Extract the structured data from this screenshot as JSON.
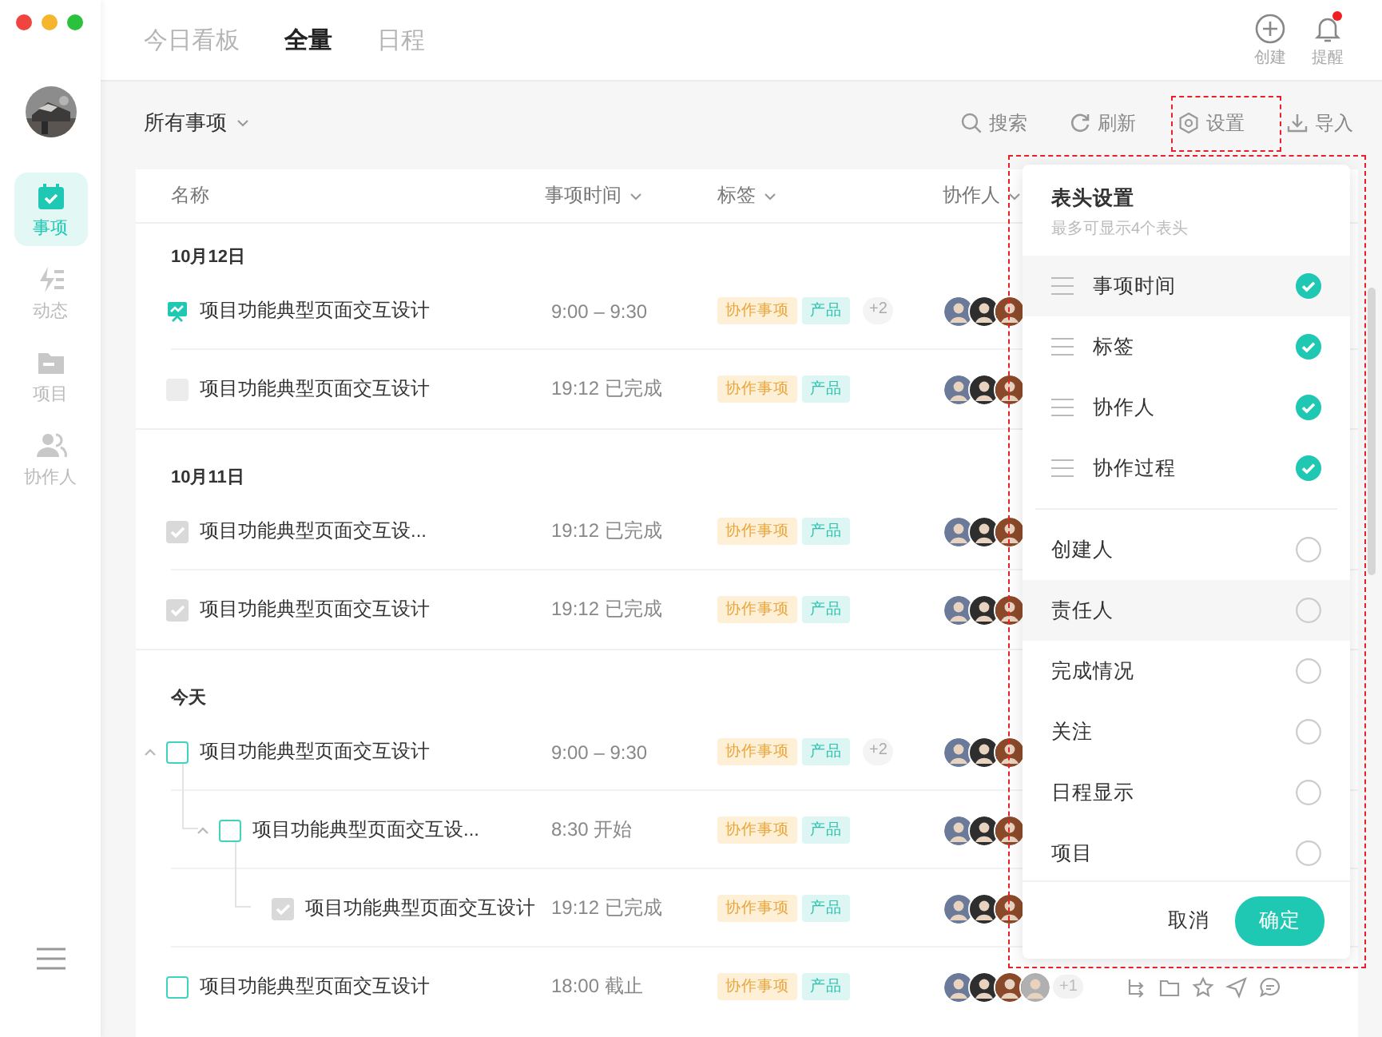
{
  "sidebar": {
    "nav": [
      {
        "label": "事项",
        "kind": "calendar",
        "selected": true
      },
      {
        "label": "动态",
        "kind": "activity",
        "selected": false
      },
      {
        "label": "项目",
        "kind": "folder",
        "selected": false
      },
      {
        "label": "协作人",
        "kind": "people",
        "selected": false
      }
    ]
  },
  "tabs": [
    {
      "label": "今日看板",
      "selected": false
    },
    {
      "label": "全量",
      "selected": true
    },
    {
      "label": "日程",
      "selected": false
    }
  ],
  "header_actions": [
    {
      "label": "创建",
      "kind": "create",
      "badge": false
    },
    {
      "label": "提醒",
      "kind": "bell",
      "badge": true
    }
  ],
  "filter": {
    "label": "所有事项"
  },
  "toolbar": [
    {
      "label": "搜索",
      "kind": "search"
    },
    {
      "label": "刷新",
      "kind": "refresh"
    },
    {
      "label": "设置",
      "kind": "settings"
    },
    {
      "label": "导入",
      "kind": "import"
    }
  ],
  "table": {
    "columns": [
      {
        "label": "名称",
        "sortable": false
      },
      {
        "label": "事项时间",
        "sortable": true
      },
      {
        "label": "标签",
        "sortable": true
      },
      {
        "label": "协作人",
        "sortable": true
      }
    ],
    "groups": [
      {
        "label": "10月12日",
        "rows": [
          {
            "title": "项目功能典型页面交互设计",
            "kind": "milestone",
            "time": "9:00 – 9:30",
            "tags": [
              {
                "label": "协作事项",
                "kind": "collab"
              },
              {
                "label": "产品",
                "kind": "product"
              },
              {
                "label": "+2",
                "kind": "more"
              }
            ]
          },
          {
            "title": "项目功能典型页面交互设计",
            "kind": "placeholder",
            "time": "19:12 已完成",
            "tags": [
              {
                "label": "协作事项",
                "kind": "collab"
              },
              {
                "label": "产品",
                "kind": "product"
              }
            ]
          }
        ]
      },
      {
        "label": "10月11日",
        "rows": [
          {
            "title": "项目功能典型页面交互设...",
            "kind": "done",
            "time": "19:12 已完成",
            "tags": [
              {
                "label": "协作事项",
                "kind": "collab"
              },
              {
                "label": "产品",
                "kind": "product"
              }
            ]
          },
          {
            "title": "项目功能典型页面交互设计",
            "kind": "done",
            "time": "19:12 已完成",
            "tags": [
              {
                "label": "协作事项",
                "kind": "collab"
              },
              {
                "label": "产品",
                "kind": "product"
              }
            ]
          }
        ]
      },
      {
        "label": "今天",
        "rows": [
          {
            "title": "项目功能典型页面交互设计",
            "kind": "open",
            "time": "9:00 – 9:30",
            "expanded": true,
            "tags": [
              {
                "label": "协作事项",
                "kind": "collab"
              },
              {
                "label": "产品",
                "kind": "product"
              },
              {
                "label": "+2",
                "kind": "more"
              }
            ],
            "children": [
              {
                "title": "项目功能典型页面交互设...",
                "kind": "open",
                "time": "8:30 开始",
                "expanded": true,
                "tags": [
                  {
                    "label": "协作事项",
                    "kind": "collab"
                  },
                  {
                    "label": "产品",
                    "kind": "product"
                  }
                ],
                "children": [
                  {
                    "title": "项目功能典型页面交互设计",
                    "kind": "done",
                    "time": "19:12 已完成",
                    "tags": [
                      {
                        "label": "协作事项",
                        "kind": "collab"
                      },
                      {
                        "label": "产品",
                        "kind": "product"
                      }
                    ]
                  }
                ]
              }
            ]
          },
          {
            "title": "项目功能典型页面交互设计",
            "kind": "open",
            "time": "18:00 截止",
            "tags": [
              {
                "label": "协作事项",
                "kind": "collab"
              },
              {
                "label": "产品",
                "kind": "product"
              }
            ],
            "more_people": "+1",
            "show_actions": true
          }
        ]
      }
    ]
  },
  "column_settings": {
    "title": "表头设置",
    "subtitle": "最多可显示4个表头",
    "items": [
      {
        "label": "事项时间",
        "checked": true,
        "draggable": true,
        "highlighted": true
      },
      {
        "label": "标签",
        "checked": true,
        "draggable": true,
        "highlighted": false
      },
      {
        "label": "协作人",
        "checked": true,
        "draggable": true,
        "highlighted": false
      },
      {
        "label": "协作过程",
        "checked": true,
        "draggable": true,
        "highlighted": false
      },
      {
        "label": "创建人",
        "checked": false,
        "draggable": false,
        "highlighted": false
      },
      {
        "label": "责任人",
        "checked": false,
        "draggable": false,
        "highlighted": true
      },
      {
        "label": "完成情况",
        "checked": false,
        "draggable": false,
        "highlighted": false
      },
      {
        "label": "关注",
        "checked": false,
        "draggable": false,
        "highlighted": false
      },
      {
        "label": "日程显示",
        "checked": false,
        "draggable": false,
        "highlighted": false
      },
      {
        "label": "项目",
        "checked": false,
        "draggable": false,
        "highlighted": false
      }
    ],
    "cancel": "取消",
    "confirm": "确定"
  }
}
